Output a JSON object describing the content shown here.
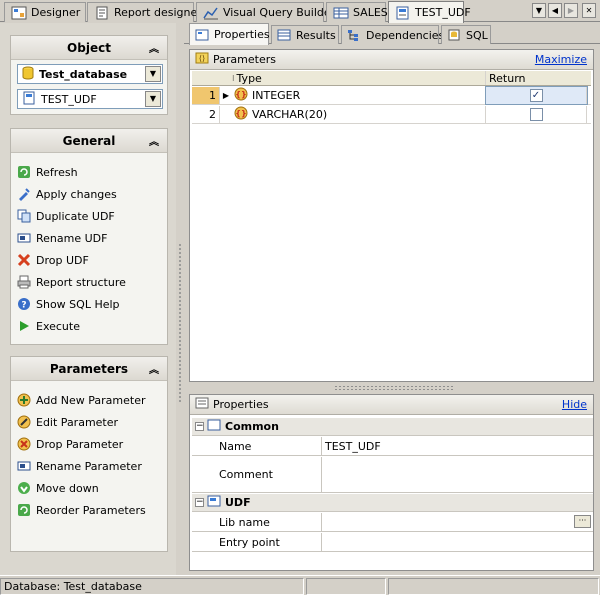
{
  "doc_tabs": [
    {
      "label": "Designer"
    },
    {
      "label": "Report designer"
    },
    {
      "label": "Visual Query Builder"
    },
    {
      "label": "SALES"
    },
    {
      "label": "TEST_UDF"
    }
  ],
  "object_group": {
    "title": "Object",
    "database": "Test_database",
    "udf": "TEST_UDF"
  },
  "general_group": {
    "title": "General",
    "items": [
      {
        "label": "Refresh",
        "icon": "refresh-icon"
      },
      {
        "label": "Apply changes",
        "icon": "apply-icon"
      },
      {
        "label": "Duplicate UDF",
        "icon": "duplicate-icon"
      },
      {
        "label": "Rename UDF",
        "icon": "rename-icon"
      },
      {
        "label": "Drop UDF",
        "icon": "drop-icon"
      },
      {
        "label": "Report structure",
        "icon": "printer-icon"
      },
      {
        "label": "Show SQL Help",
        "icon": "help-icon"
      },
      {
        "label": "Execute",
        "icon": "play-icon"
      }
    ]
  },
  "parameters_group": {
    "title": "Parameters",
    "items": [
      {
        "label": "Add New Parameter",
        "icon": "add-param-icon"
      },
      {
        "label": "Edit Parameter",
        "icon": "edit-param-icon"
      },
      {
        "label": "Drop Parameter",
        "icon": "drop-param-icon"
      },
      {
        "label": "Rename Parameter",
        "icon": "rename-param-icon"
      },
      {
        "label": "Move down",
        "icon": "move-down-icon"
      },
      {
        "label": "Reorder Parameters",
        "icon": "reorder-icon"
      }
    ]
  },
  "sub_tabs": [
    {
      "label": "Properties"
    },
    {
      "label": "Results"
    },
    {
      "label": "Dependencies"
    },
    {
      "label": "SQL"
    }
  ],
  "parameters_panel": {
    "title": "Parameters",
    "link": "Maximize",
    "columns": {
      "type": "Type",
      "return": "Return"
    },
    "rows": [
      {
        "num": "1",
        "type": "INTEGER",
        "return": true
      },
      {
        "num": "2",
        "type": "VARCHAR(20)",
        "return": false
      }
    ]
  },
  "properties_panel": {
    "title": "Properties",
    "link": "Hide",
    "categories": [
      {
        "name": "Common",
        "props": [
          {
            "name": "Name",
            "value": "TEST_UDF"
          },
          {
            "name": "Comment",
            "value": ""
          }
        ]
      },
      {
        "name": "UDF",
        "props": [
          {
            "name": "Lib name",
            "value": ""
          },
          {
            "name": "Entry point",
            "value": ""
          }
        ]
      }
    ]
  },
  "status_bar": {
    "database": "Database: Test_database"
  }
}
